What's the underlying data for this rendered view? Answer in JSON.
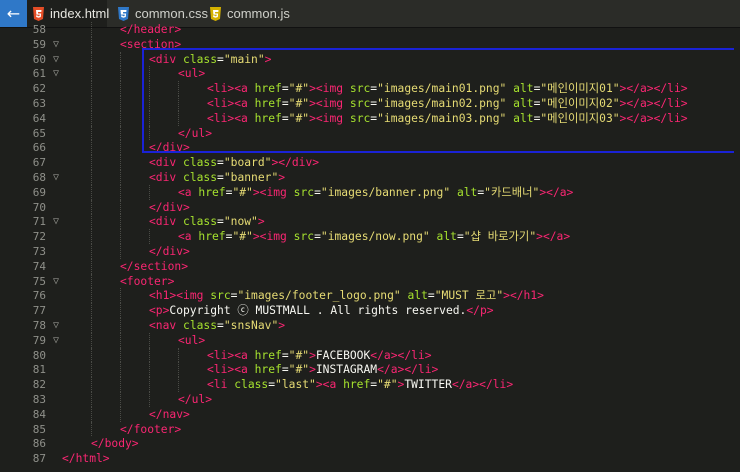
{
  "tabs": [
    {
      "label": "index.html",
      "icon": "html5-icon",
      "active": true,
      "icon_color": "#e44d26"
    },
    {
      "label": "common.css",
      "icon": "css3-icon",
      "active": false,
      "icon_color": "#2f78c8"
    },
    {
      "label": "common.js",
      "icon": "js-icon",
      "active": false,
      "icon_color": "#d4b100"
    }
  ],
  "back_button": "←",
  "highlight_color": "#1a22d6",
  "lines": [
    {
      "n": "58",
      "fold": "",
      "indent": 4,
      "tokens": [
        [
          "tg",
          "</header>"
        ]
      ]
    },
    {
      "n": "59",
      "fold": "▽",
      "indent": 4,
      "tokens": [
        [
          "tg",
          "<section>"
        ]
      ]
    },
    {
      "n": "60",
      "fold": "▽",
      "indent": 6,
      "tokens": [
        [
          "tg",
          "<div "
        ],
        [
          "at",
          "class"
        ],
        [
          "tx",
          "="
        ],
        [
          "st",
          "\"main\""
        ],
        [
          "tg",
          ">"
        ]
      ]
    },
    {
      "n": "61",
      "fold": "▽",
      "indent": 8,
      "tokens": [
        [
          "tg",
          "<ul>"
        ]
      ]
    },
    {
      "n": "62",
      "fold": "",
      "indent": 10,
      "tokens": [
        [
          "tg",
          "<li>"
        ],
        [
          "tg",
          "<a "
        ],
        [
          "at",
          "href"
        ],
        [
          "tx",
          "="
        ],
        [
          "st",
          "\"#\""
        ],
        [
          "tg",
          ">"
        ],
        [
          "tg",
          "<img "
        ],
        [
          "at",
          "src"
        ],
        [
          "tx",
          "="
        ],
        [
          "st",
          "\"images/main01.png\""
        ],
        [
          "tx",
          " "
        ],
        [
          "at",
          "alt"
        ],
        [
          "tx",
          "="
        ],
        [
          "st",
          "\"메인이미지01\""
        ],
        [
          "tg",
          ">"
        ],
        [
          "tg",
          "</a>"
        ],
        [
          "tg",
          "</li>"
        ]
      ]
    },
    {
      "n": "63",
      "fold": "",
      "indent": 10,
      "tokens": [
        [
          "tg",
          "<li>"
        ],
        [
          "tg",
          "<a "
        ],
        [
          "at",
          "href"
        ],
        [
          "tx",
          "="
        ],
        [
          "st",
          "\"#\""
        ],
        [
          "tg",
          ">"
        ],
        [
          "tg",
          "<img "
        ],
        [
          "at",
          "src"
        ],
        [
          "tx",
          "="
        ],
        [
          "st",
          "\"images/main02.png\""
        ],
        [
          "tx",
          " "
        ],
        [
          "at",
          "alt"
        ],
        [
          "tx",
          "="
        ],
        [
          "st",
          "\"메인이미지02\""
        ],
        [
          "tg",
          ">"
        ],
        [
          "tg",
          "</a>"
        ],
        [
          "tg",
          "</li>"
        ]
      ]
    },
    {
      "n": "64",
      "fold": "",
      "indent": 10,
      "tokens": [
        [
          "tg",
          "<li>"
        ],
        [
          "tg",
          "<a "
        ],
        [
          "at",
          "href"
        ],
        [
          "tx",
          "="
        ],
        [
          "st",
          "\"#\""
        ],
        [
          "tg",
          ">"
        ],
        [
          "tg",
          "<img "
        ],
        [
          "at",
          "src"
        ],
        [
          "tx",
          "="
        ],
        [
          "st",
          "\"images/main03.png\""
        ],
        [
          "tx",
          " "
        ],
        [
          "at",
          "alt"
        ],
        [
          "tx",
          "="
        ],
        [
          "st",
          "\"메인이미지03\""
        ],
        [
          "tg",
          ">"
        ],
        [
          "tg",
          "</a>"
        ],
        [
          "tg",
          "</li>"
        ]
      ]
    },
    {
      "n": "65",
      "fold": "",
      "indent": 8,
      "tokens": [
        [
          "tg",
          "</ul>"
        ]
      ]
    },
    {
      "n": "66",
      "fold": "",
      "indent": 6,
      "tokens": [
        [
          "tg",
          "</div>"
        ]
      ]
    },
    {
      "n": "67",
      "fold": "",
      "indent": 6,
      "tokens": [
        [
          "tg",
          "<div "
        ],
        [
          "at",
          "class"
        ],
        [
          "tx",
          "="
        ],
        [
          "st",
          "\"board\""
        ],
        [
          "tg",
          ">"
        ],
        [
          "tg",
          "</div>"
        ]
      ]
    },
    {
      "n": "68",
      "fold": "▽",
      "indent": 6,
      "tokens": [
        [
          "tg",
          "<div "
        ],
        [
          "at",
          "class"
        ],
        [
          "tx",
          "="
        ],
        [
          "st",
          "\"banner\""
        ],
        [
          "tg",
          ">"
        ]
      ]
    },
    {
      "n": "69",
      "fold": "",
      "indent": 8,
      "tokens": [
        [
          "tg",
          "<a "
        ],
        [
          "at",
          "href"
        ],
        [
          "tx",
          "="
        ],
        [
          "st",
          "\"#\""
        ],
        [
          "tg",
          ">"
        ],
        [
          "tg",
          "<img "
        ],
        [
          "at",
          "src"
        ],
        [
          "tx",
          "="
        ],
        [
          "st",
          "\"images/banner.png\""
        ],
        [
          "tx",
          " "
        ],
        [
          "at",
          "alt"
        ],
        [
          "tx",
          "="
        ],
        [
          "st",
          "\"카드배너\""
        ],
        [
          "tg",
          ">"
        ],
        [
          "tg",
          "</a>"
        ]
      ]
    },
    {
      "n": "70",
      "fold": "",
      "indent": 6,
      "tokens": [
        [
          "tg",
          "</div>"
        ]
      ]
    },
    {
      "n": "71",
      "fold": "▽",
      "indent": 6,
      "tokens": [
        [
          "tg",
          "<div "
        ],
        [
          "at",
          "class"
        ],
        [
          "tx",
          "="
        ],
        [
          "st",
          "\"now\""
        ],
        [
          "tg",
          ">"
        ]
      ]
    },
    {
      "n": "72",
      "fold": "",
      "indent": 8,
      "tokens": [
        [
          "tg",
          "<a "
        ],
        [
          "at",
          "href"
        ],
        [
          "tx",
          "="
        ],
        [
          "st",
          "\"#\""
        ],
        [
          "tg",
          ">"
        ],
        [
          "tg",
          "<img "
        ],
        [
          "at",
          "src"
        ],
        [
          "tx",
          "="
        ],
        [
          "st",
          "\"images/now.png\""
        ],
        [
          "tx",
          " "
        ],
        [
          "at",
          "alt"
        ],
        [
          "tx",
          "="
        ],
        [
          "st",
          "\"샵 바로가기\""
        ],
        [
          "tg",
          ">"
        ],
        [
          "tg",
          "</a>"
        ]
      ]
    },
    {
      "n": "73",
      "fold": "",
      "indent": 6,
      "tokens": [
        [
          "tg",
          "</div>"
        ]
      ]
    },
    {
      "n": "74",
      "fold": "",
      "indent": 4,
      "tokens": [
        [
          "tg",
          "</section>"
        ]
      ]
    },
    {
      "n": "75",
      "fold": "▽",
      "indent": 4,
      "tokens": [
        [
          "tg",
          "<footer>"
        ]
      ]
    },
    {
      "n": "76",
      "fold": "",
      "indent": 6,
      "tokens": [
        [
          "tg",
          "<h1>"
        ],
        [
          "tg",
          "<img "
        ],
        [
          "at",
          "src"
        ],
        [
          "tx",
          "="
        ],
        [
          "st",
          "\"images/footer_logo.png\""
        ],
        [
          "tx",
          " "
        ],
        [
          "at",
          "alt"
        ],
        [
          "tx",
          "="
        ],
        [
          "st",
          "\"MUST 로고\""
        ],
        [
          "tg",
          ">"
        ],
        [
          "tg",
          "</h1>"
        ]
      ]
    },
    {
      "n": "77",
      "fold": "",
      "indent": 6,
      "tokens": [
        [
          "tg",
          "<p>"
        ],
        [
          "tx",
          "Copyright ⓒ MUSTMALL . All rights reserved."
        ],
        [
          "tg",
          "</p>"
        ]
      ]
    },
    {
      "n": "78",
      "fold": "▽",
      "indent": 6,
      "tokens": [
        [
          "tg",
          "<nav "
        ],
        [
          "at",
          "class"
        ],
        [
          "tx",
          "="
        ],
        [
          "st",
          "\"snsNav\""
        ],
        [
          "tg",
          ">"
        ]
      ]
    },
    {
      "n": "79",
      "fold": "▽",
      "indent": 8,
      "tokens": [
        [
          "tg",
          "<ul>"
        ]
      ]
    },
    {
      "n": "80",
      "fold": "",
      "indent": 10,
      "tokens": [
        [
          "tg",
          "<li>"
        ],
        [
          "tg",
          "<a "
        ],
        [
          "at",
          "href"
        ],
        [
          "tx",
          "="
        ],
        [
          "st",
          "\"#\""
        ],
        [
          "tg",
          ">"
        ],
        [
          "tx",
          "FACEBOOK"
        ],
        [
          "tg",
          "</a>"
        ],
        [
          "tg",
          "</li>"
        ]
      ]
    },
    {
      "n": "81",
      "fold": "",
      "indent": 10,
      "tokens": [
        [
          "tg",
          "<li>"
        ],
        [
          "tg",
          "<a "
        ],
        [
          "at",
          "href"
        ],
        [
          "tx",
          "="
        ],
        [
          "st",
          "\"#\""
        ],
        [
          "tg",
          ">"
        ],
        [
          "tx",
          "INSTAGRAM"
        ],
        [
          "tg",
          "</a>"
        ],
        [
          "tg",
          "</li>"
        ]
      ]
    },
    {
      "n": "82",
      "fold": "",
      "indent": 10,
      "tokens": [
        [
          "tg",
          "<li "
        ],
        [
          "at",
          "class"
        ],
        [
          "tx",
          "="
        ],
        [
          "st",
          "\"last\""
        ],
        [
          "tg",
          ">"
        ],
        [
          "tg",
          "<a "
        ],
        [
          "at",
          "href"
        ],
        [
          "tx",
          "="
        ],
        [
          "st",
          "\"#\""
        ],
        [
          "tg",
          ">"
        ],
        [
          "tx",
          "TWITTER"
        ],
        [
          "tg",
          "</a>"
        ],
        [
          "tg",
          "</li>"
        ]
      ]
    },
    {
      "n": "83",
      "fold": "",
      "indent": 8,
      "tokens": [
        [
          "tg",
          "</ul>"
        ]
      ]
    },
    {
      "n": "84",
      "fold": "",
      "indent": 6,
      "tokens": [
        [
          "tg",
          "</nav>"
        ]
      ]
    },
    {
      "n": "85",
      "fold": "",
      "indent": 4,
      "tokens": [
        [
          "tg",
          "</footer>"
        ]
      ]
    },
    {
      "n": "86",
      "fold": "",
      "indent": 2,
      "tokens": [
        [
          "tg",
          "</body>"
        ]
      ]
    },
    {
      "n": "87",
      "fold": "",
      "indent": 0,
      "tokens": [
        [
          "tg",
          "</html>"
        ]
      ]
    }
  ]
}
